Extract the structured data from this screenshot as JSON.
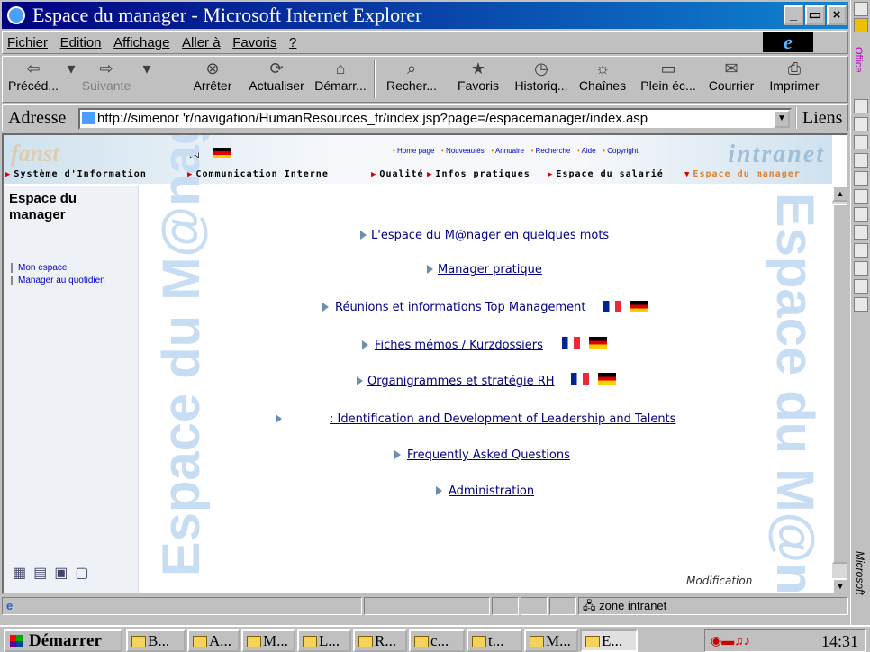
{
  "window": {
    "title": "Espace du manager - Microsoft Internet Explorer",
    "controls": [
      "_",
      "▭",
      "×"
    ]
  },
  "menu": [
    "Fichier",
    "Edition",
    "Affichage",
    "Aller à",
    "Favoris",
    "?"
  ],
  "toolbar": {
    "back": "Précéd...",
    "forward": "Suivante",
    "stop": "Arrêter",
    "refresh": "Actualiser",
    "home": "Démarr...",
    "search": "Recher...",
    "favorites": "Favoris",
    "history": "Historiq...",
    "channels": "Chaînes",
    "fullscreen": "Plein éc...",
    "mail": "Courrier",
    "print": "Imprimer"
  },
  "address": {
    "label": "Adresse",
    "url": "http://simenor                          'r/navigation/HumanResources_fr/index.jsp?page=/espacemanager/index.asp",
    "links": "Liens"
  },
  "banner": {
    "left_logo": "fanst",
    "right_logo": "intranet",
    "topnav": [
      "Home page",
      "Nouveautés",
      "Annuaire",
      "Recherche",
      "Aide",
      "Copyright"
    ]
  },
  "sections": [
    "Système d'Information",
    "Communication Interne",
    "Qualité",
    "Infos pratiques",
    "Espace du salarié",
    "Espace du manager"
  ],
  "sidebar": {
    "title": "Espace du manager",
    "links": [
      "Mon espace",
      "Manager au quotidien"
    ]
  },
  "main": {
    "watermark": "Espace du M@nager",
    "watermark_right": "Espace du M@na",
    "links": [
      "L'espace du M@nager en quelques mots",
      "Manager pratique",
      "Réunions et informations Top Management",
      "Fiches mémos / Kurzdossiers",
      "Organigrammes et stratégie RH",
      ": Identification and Development of Leadership and Talents",
      "Frequently Asked Questions",
      "Administration"
    ],
    "modification": "Modification"
  },
  "status": {
    "zone": "zone intranet"
  },
  "taskbar": {
    "start": "Démarrer",
    "tasks": [
      "B...",
      "A...",
      "M...",
      "L...",
      "R...",
      "c...",
      "t...",
      "M...",
      "E..."
    ],
    "clock": "14:31"
  },
  "officebar": {
    "label": "Office",
    "vendor": "Microsoft"
  },
  "colors": {
    "title_start": "#000080",
    "title_end": "#1084d0",
    "link": "#000080",
    "watermark": "#c7ddf3",
    "active_section": "#e08030"
  }
}
